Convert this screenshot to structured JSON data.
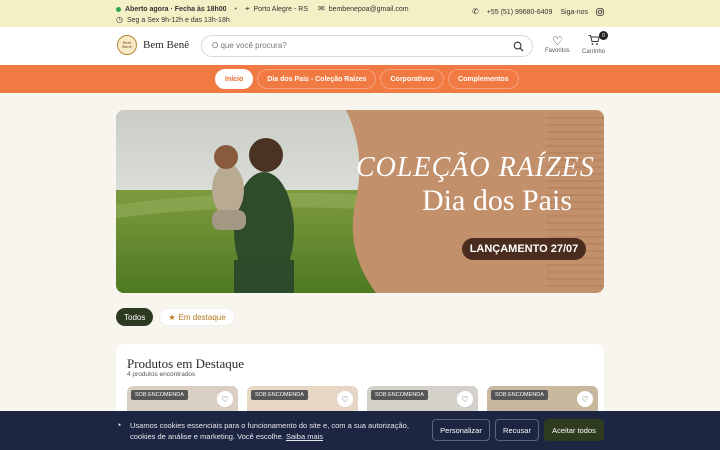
{
  "topbar": {
    "status": "Aberto agora · Fecha às 18h00",
    "location": "Porto Alegre - RS",
    "email": "bembenepoa@gmail.com",
    "hours": "Seg a Sex 9h-12h e das 13h-18h",
    "phone": "+55 (51) 99680-6409",
    "follow": "Siga-nos"
  },
  "header": {
    "brand": "Bem Benê",
    "badge": "Bem Benê",
    "search_placeholder": "O que você procura?",
    "favorites": "Favoritos",
    "cart": "Carrinho",
    "cart_count": "0"
  },
  "nav": [
    "Início",
    "Dia dos Pais - Coleção Raízes",
    "Corporativos",
    "Complementos"
  ],
  "banner": {
    "line1": "COLEÇÃO RAÍZES",
    "line2": "Dia dos Pais",
    "launch": "LANÇAMENTO 27/07"
  },
  "filters": {
    "all": "Todos",
    "featured": "Em destaque"
  },
  "featured": {
    "title": "Produtos em Destaque",
    "count": "4 produtos encontrados",
    "tag": "SOB ENCOMENDA"
  },
  "cookie": {
    "text": "Usamos cookies essenciais para o funcionamento do site e, com a sua autorização, cookies de análise e marketing. Você escolhe.",
    "link": "Saiba mais",
    "customize": "Personalizar",
    "reject": "Recusar",
    "accept": "Aceitar todos"
  },
  "colors": {
    "nav": "#f07a42",
    "cookie_bg": "#1c2541",
    "accept": "#2e3b1f",
    "topbar": "#f4f0c6"
  }
}
